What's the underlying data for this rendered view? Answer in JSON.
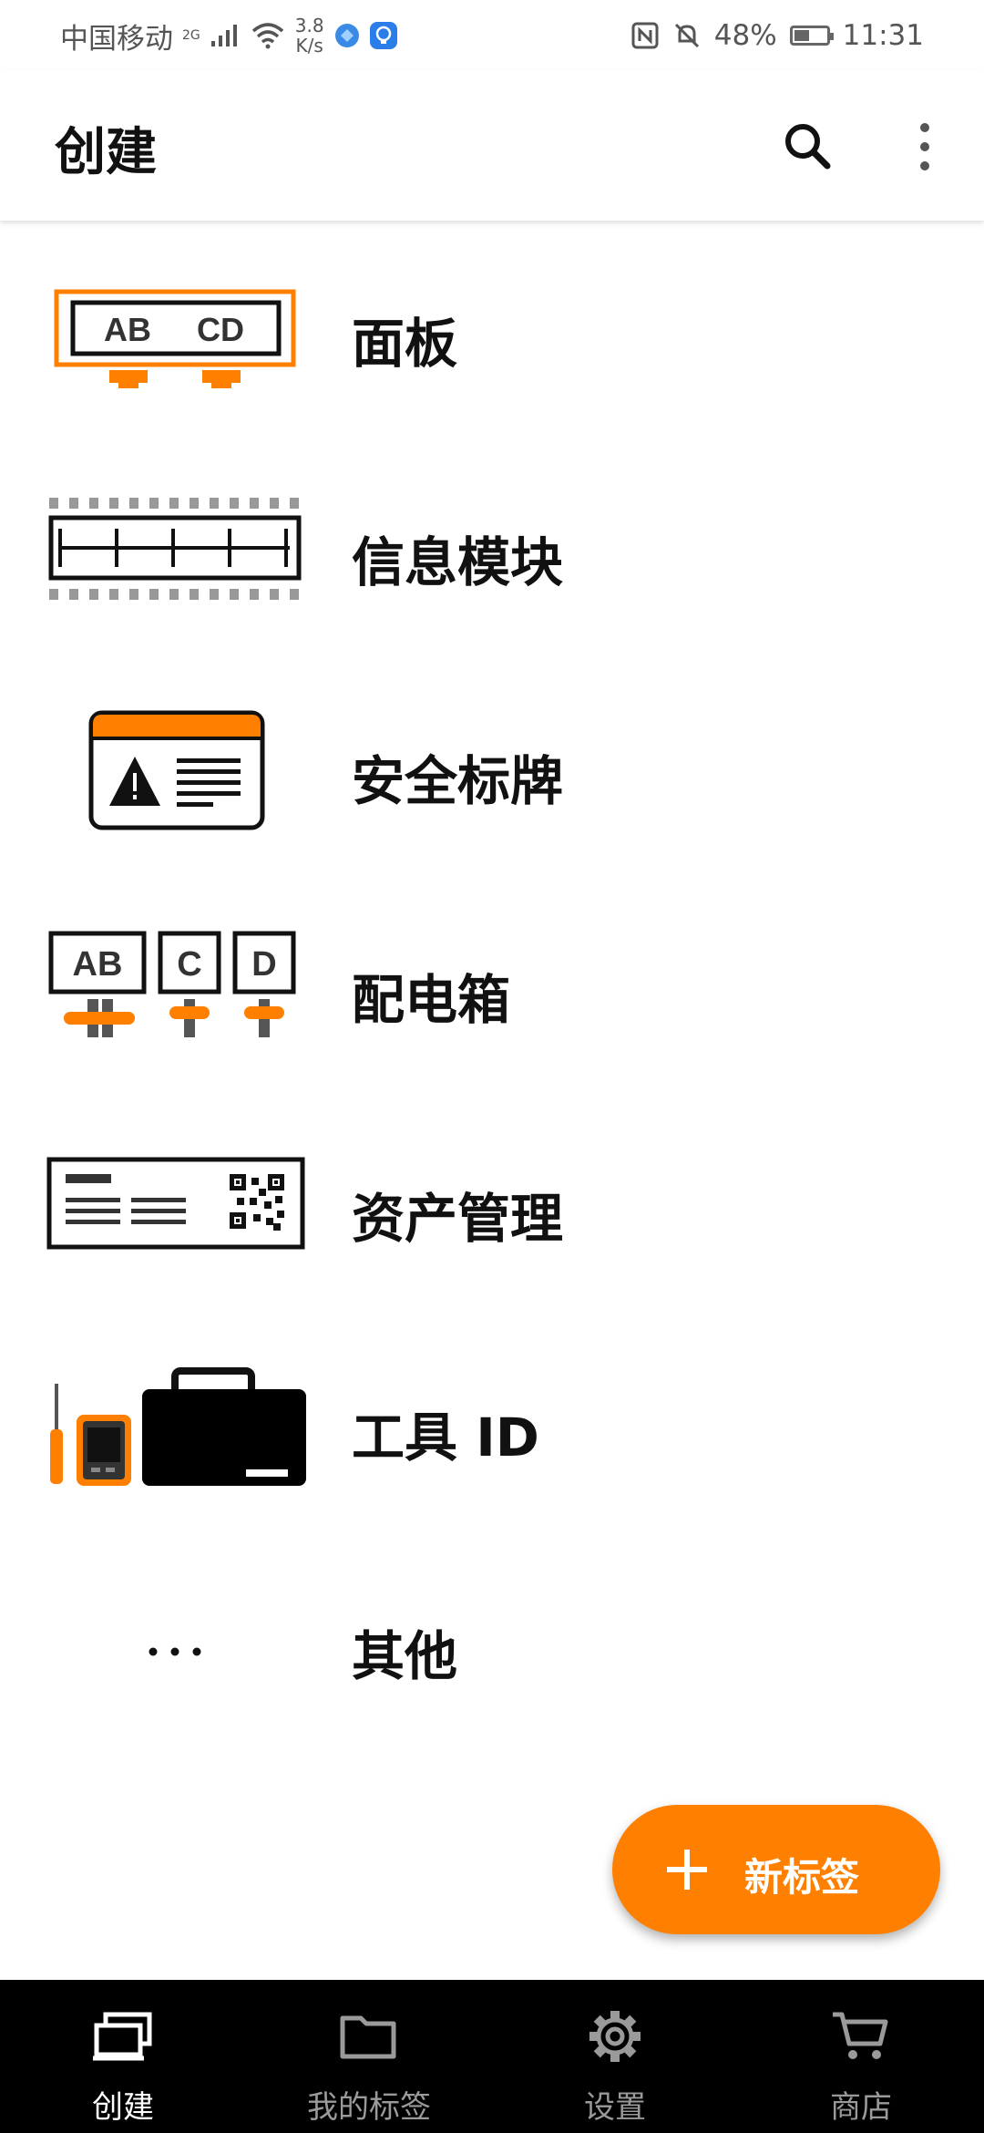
{
  "status": {
    "carrier": "中国移动",
    "network": "2G",
    "speed_value": "3.8",
    "speed_unit": "K/s",
    "battery": "48%",
    "battery_level": 0.48,
    "time": "11:31"
  },
  "appbar": {
    "title": "创建"
  },
  "list": {
    "items": [
      {
        "label": "面板"
      },
      {
        "label": "信息模块"
      },
      {
        "label": "安全标牌"
      },
      {
        "label": "配电箱"
      },
      {
        "label": "资产管理"
      },
      {
        "label": "工具 ID"
      },
      {
        "label": "其他"
      }
    ],
    "icon_text": {
      "panel_ab": "AB",
      "panel_cd": "CD",
      "box_ab": "AB",
      "box_c": "C",
      "box_d": "D",
      "others": "•••"
    }
  },
  "fab": {
    "label": "新标签"
  },
  "bottom_nav": {
    "items": [
      {
        "label": "创建"
      },
      {
        "label": "我的标签"
      },
      {
        "label": "设置"
      },
      {
        "label": "商店"
      }
    ]
  },
  "colors": {
    "accent": "#ff7f00",
    "nav_bg": "#000000",
    "nav_inactive": "#9a9a9a"
  }
}
